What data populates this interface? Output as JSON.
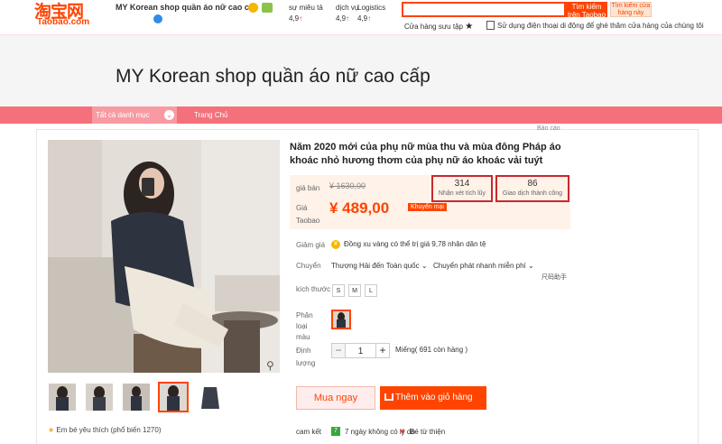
{
  "header": {
    "logo_cn": "淘宝网",
    "logo_en": "Taobao.com",
    "shop_name": "MY Korean shop quần áo nữ cao cấp",
    "ratings": [
      {
        "label": "sự miêu tả",
        "value": "4,9"
      },
      {
        "label": "dịch vụ",
        "value": "4,9"
      },
      {
        "label": "Logistics",
        "value": "4,9"
      }
    ],
    "search_button": "Tìm kiếm trên Taobao",
    "shop_search_button": "Tìm kiếm cửa hàng này",
    "favorites_link": "Cửa hàng sưu tập",
    "mobile_text": "Sử dụng điện thoại di động để ghé thăm cửa hàng của chúng tôi"
  },
  "banner": {
    "title": "MY Korean shop quần áo nữ cao cấp"
  },
  "nav": {
    "all_categories": "Tất cả danh mục",
    "home": "Trang Chủ"
  },
  "product": {
    "report": "Báo cáo",
    "title": "Năm 2020 mới của phụ nữ mùa thu và mùa đông Pháp áo khoác nhỏ hương thơm của phụ nữ áo khoác vải tuýt",
    "price_label": "giá bán",
    "old_price": "¥ 1630,00",
    "taobao_price_label": "Giá Taobao",
    "price": "¥ 489,00",
    "promo": "Khuyến mại",
    "reviews_count": "314",
    "reviews_label": "Nhận xét tích lũy",
    "sales_count": "86",
    "sales_label": "Giao dịch thành công",
    "discount_label": "Giảm giá",
    "coin_text": "Đồng xu vàng có thể trị giá 9,78 nhân dân tệ",
    "shipping_label": "Chuyển",
    "shipping_from": "Thượng Hải đến Toàn quốc",
    "shipping_method": "Chuyển phát nhanh miễn phí",
    "size_label": "kích thước",
    "size_tag": "尺码助手",
    "sizes": [
      "S",
      "M",
      "L"
    ],
    "variant_label": "Phân loại màu",
    "qty_label": "Định lượng",
    "qty_value": "1",
    "stock": "Miếng( 691 còn hàng )",
    "buy_now": "Mua ngay",
    "add_to_cart": "Thêm  vào giỏ hàng",
    "favorite_text": "Em bé yêu thích (phổ biến 1270)",
    "commit_label": "cam kết",
    "commit_return": "7 ngày không có lý do",
    "commit_charity": "Bé từ thiện"
  },
  "colors": {
    "brand": "#ff4400",
    "nav": "#f4707b",
    "highlight": "#c8282f"
  }
}
